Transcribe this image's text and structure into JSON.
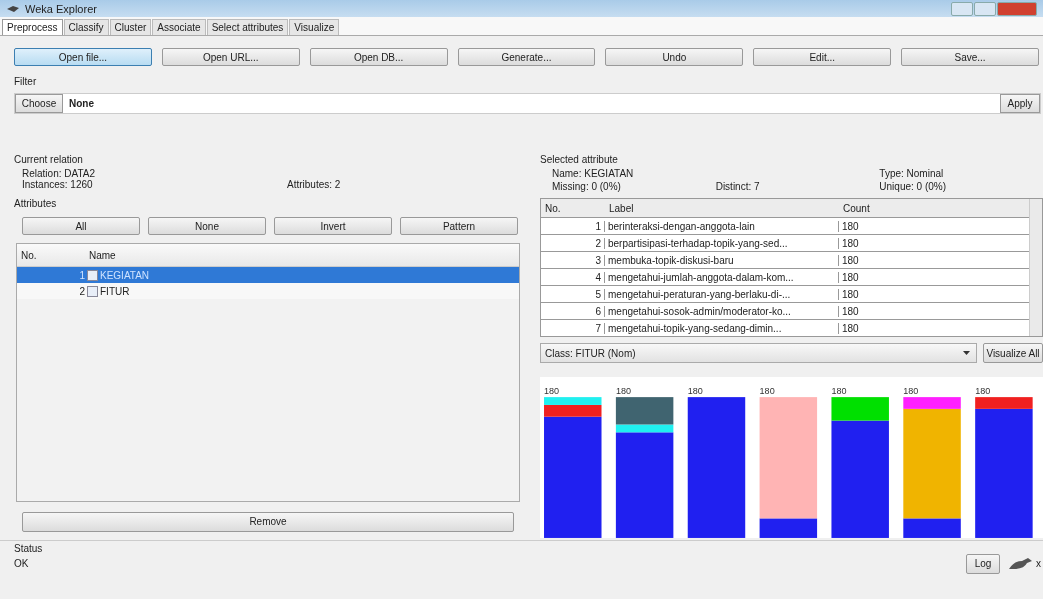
{
  "window": {
    "title": "Weka Explorer"
  },
  "tabs": [
    {
      "label": "Preprocess",
      "selected": true
    },
    {
      "label": "Classify",
      "selected": false
    },
    {
      "label": "Cluster",
      "selected": false
    },
    {
      "label": "Associate",
      "selected": false
    },
    {
      "label": "Select attributes",
      "selected": false
    },
    {
      "label": "Visualize",
      "selected": false
    }
  ],
  "toolbar_buttons": [
    {
      "label": "Open file...",
      "selected": true
    },
    {
      "label": "Open URL...",
      "selected": false
    },
    {
      "label": "Open DB...",
      "selected": false
    },
    {
      "label": "Generate...",
      "selected": false
    },
    {
      "label": "Undo",
      "selected": false
    },
    {
      "label": "Edit...",
      "selected": false
    },
    {
      "label": "Save...",
      "selected": false
    }
  ],
  "filter": {
    "title": "Filter",
    "choose_button": "Choose",
    "value": "None",
    "apply_button": "Apply"
  },
  "current_relation": {
    "title": "Current relation",
    "relation": "Relation: DATA2",
    "instances": "Instances: 1260",
    "attributes": "Attributes: 2"
  },
  "attributes": {
    "title": "Attributes",
    "buttons": [
      "All",
      "None",
      "Invert",
      "Pattern"
    ],
    "columns": [
      "No.",
      "Name"
    ],
    "rows": [
      {
        "no": "1",
        "name": "KEGIATAN",
        "checked": false,
        "selected": true
      },
      {
        "no": "2",
        "name": "FITUR",
        "checked": false,
        "selected": false
      }
    ],
    "remove_button": "Remove"
  },
  "selected_attribute": {
    "title": "Selected attribute",
    "name": "Name: KEGIATAN",
    "missing": "Missing: 0 (0%)",
    "distinct": "Distinct: 7",
    "type": "Type: Nominal",
    "unique": "Unique: 0 (0%)",
    "columns": [
      "No.",
      "Label",
      "Count"
    ],
    "rows": [
      {
        "no": "1",
        "label": "berinteraksi-dengan-anggota-lain",
        "count": "180"
      },
      {
        "no": "2",
        "label": "berpartisipasi-terhadap-topik-yang-sed...",
        "count": "180"
      },
      {
        "no": "3",
        "label": "membuka-topik-diskusi-baru",
        "count": "180"
      },
      {
        "no": "4",
        "label": "mengetahui-jumlah-anggota-dalam-kom...",
        "count": "180"
      },
      {
        "no": "5",
        "label": "mengetahui-peraturan-yang-berlaku-di-...",
        "count": "180"
      },
      {
        "no": "6",
        "label": "mengetahui-sosok-admin/moderator-ko...",
        "count": "180"
      },
      {
        "no": "7",
        "label": "mengetahui-topik-yang-sedang-dimin...",
        "count": "180"
      }
    ]
  },
  "class_selector": {
    "value": "Class: FITUR (Nom)",
    "button": "Visualize All"
  },
  "histogram": {
    "bar_labels": [
      "180",
      "180",
      "180",
      "180",
      "180",
      "180",
      "180"
    ]
  },
  "status": {
    "title": "Status",
    "message": "OK",
    "log_button": "Log",
    "count": "x"
  }
}
